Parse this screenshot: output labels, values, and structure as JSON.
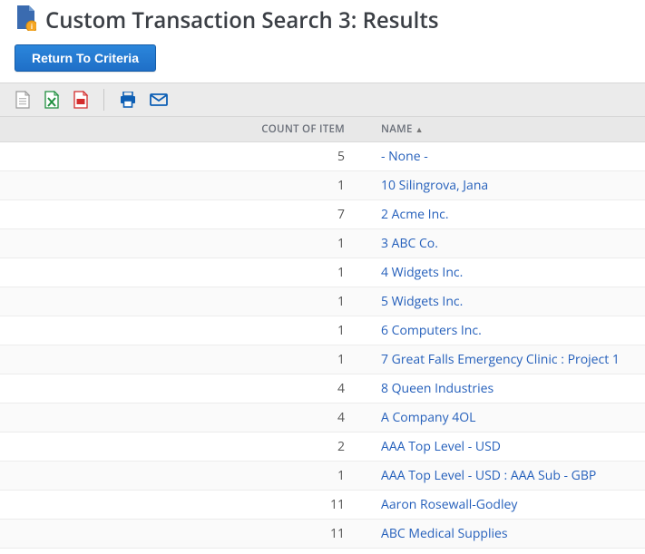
{
  "header": {
    "title": "Custom Transaction Search 3: Results"
  },
  "buttons": {
    "return_to_criteria": "Return To Criteria"
  },
  "table": {
    "headers": {
      "count": "COUNT OF ITEM",
      "name": "NAME"
    },
    "sort_indicator": "▲",
    "rows": [
      {
        "count": "5",
        "name": "- None -"
      },
      {
        "count": "1",
        "name": "10 Silingrova, Jana"
      },
      {
        "count": "7",
        "name": "2 Acme Inc."
      },
      {
        "count": "1",
        "name": "3 ABC Co."
      },
      {
        "count": "1",
        "name": "4 Widgets Inc."
      },
      {
        "count": "1",
        "name": "5 Widgets Inc."
      },
      {
        "count": "1",
        "name": "6 Computers Inc."
      },
      {
        "count": "1",
        "name": "7 Great Falls Emergency Clinic : Project 1"
      },
      {
        "count": "4",
        "name": "8 Queen Industries"
      },
      {
        "count": "4",
        "name": "A Company 4OL"
      },
      {
        "count": "2",
        "name": "AAA Top Level - USD"
      },
      {
        "count": "1",
        "name": "AAA Top Level - USD : AAA Sub - GBP"
      },
      {
        "count": "11",
        "name": "Aaron Rosewall-Godley"
      },
      {
        "count": "11",
        "name": "ABC Medical Supplies"
      }
    ]
  }
}
